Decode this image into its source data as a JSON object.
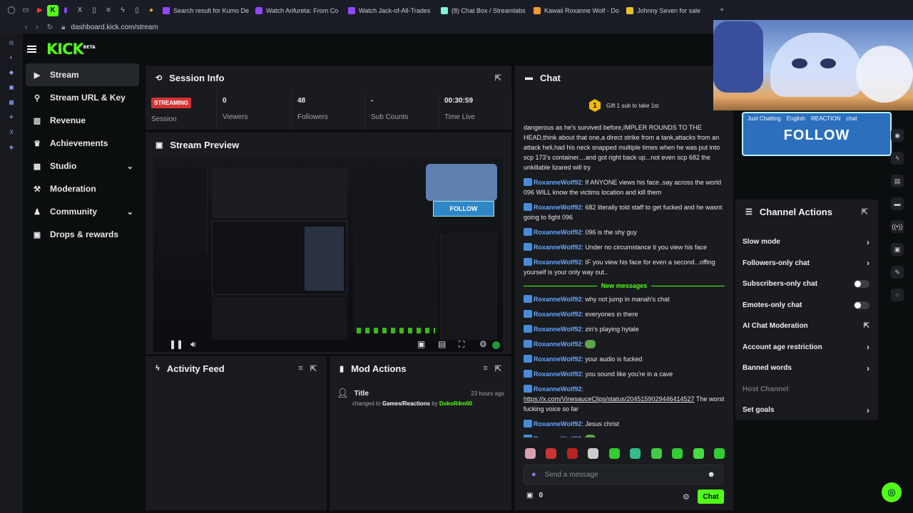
{
  "browser": {
    "tabs": [
      {
        "label": "Search result for Kumo De",
        "color": "#9146ff"
      },
      {
        "label": "Watch Arifureta: From Co",
        "color": "#9146ff"
      },
      {
        "label": "Watch Jack-of-All-Trades",
        "color": "#9146ff"
      },
      {
        "label": "(8) Chat Box / Streamlabs",
        "color": "#80f5d2"
      },
      {
        "label": "Kawaii Roxanne Wolf - Do",
        "color": "#f09a36"
      },
      {
        "label": "Johnny Seven for sale",
        "color": "#e6c229"
      }
    ],
    "url": "dashboard.kick.com/stream"
  },
  "brand": {
    "logo": "KICK",
    "beta": "BETA",
    "accent": "#53fc18"
  },
  "nav": {
    "items": [
      {
        "label": "Stream",
        "icon": "video-icon"
      },
      {
        "label": "Stream URL & Key",
        "icon": "link-icon"
      },
      {
        "label": "Revenue",
        "icon": "chart-icon"
      },
      {
        "label": "Achievements",
        "icon": "trophy-icon"
      },
      {
        "label": "Studio",
        "icon": "grid-icon"
      },
      {
        "label": "Moderation",
        "icon": "gavel-icon"
      },
      {
        "label": "Community",
        "icon": "people-icon"
      },
      {
        "label": "Drops & rewards",
        "icon": "gift-icon"
      }
    ]
  },
  "session": {
    "title": "Session Info",
    "status_badge": "STREAMING",
    "stats": [
      {
        "value": "",
        "label": "Session"
      },
      {
        "value": "0",
        "label": "Viewers"
      },
      {
        "value": "48",
        "label": "Followers"
      },
      {
        "value": "-",
        "label": "Sub Counts"
      },
      {
        "value": "00:30:59",
        "label": "Time Live"
      }
    ]
  },
  "preview": {
    "title": "Stream Preview"
  },
  "activity": {
    "title": "Activity Feed"
  },
  "mod": {
    "title": "Mod Actions",
    "entry": {
      "title": "Title",
      "time": "23 hours ago",
      "prefix": "changed to",
      "category": "Games/Reactions",
      "by": "by",
      "moderator": "DokoR4m60"
    }
  },
  "chat": {
    "title": "Chat",
    "gift_count": "1",
    "gift_text": "Gift 1 sub to take 1st",
    "top_text": "dangerous as he's survived before,IMPLER ROUNDS TO THE HEAD,think about that one,a direct strike from a tank,attacks from an attack heli,had his neck snapped multiple times when he was put into scp 173's container....and got right back up...not even scp 682 the unkillable lizared will try",
    "messages": [
      {
        "user": "RoxanneWolf92",
        "text": "If ANYONE views his face..say across the world 096 WILL know the victims location and kill them"
      },
      {
        "user": "RoxanneWolf92",
        "text": "682 literally told staff to get fucked and he wasnt going to fight 096"
      },
      {
        "user": "RoxanneWolf92",
        "text": "096 is the shy guy"
      },
      {
        "user": "RoxanneWolf92",
        "text": "Under no circumstance ti you view his face"
      },
      {
        "user": "RoxanneWolf92",
        "text": "IF you view his face for even a second...offing yourself is your only way out.."
      }
    ],
    "new_messages_label": "New messages",
    "new": [
      {
        "user": "RoxanneWolf92",
        "text": "why not jump in manah's chat"
      },
      {
        "user": "RoxanneWolf92",
        "text": "everyones in there"
      },
      {
        "user": "RoxanneWolf92",
        "text": "zin's playing hytale"
      },
      {
        "user": "RoxanneWolf92",
        "text": ""
      },
      {
        "user": "RoxanneWolf92",
        "text": "your audio is fucked"
      },
      {
        "user": "RoxanneWolf92",
        "text": "you sound like you're in a cave"
      }
    ],
    "link_msg": {
      "user": "RoxanneWolf92",
      "link": "https://x.com/VinesauceClips/status/2045159029446414527",
      "text": "The worst fucking voice so far"
    },
    "last": [
      {
        "user": "RoxanneWolf92",
        "text": "Jesus christ"
      },
      {
        "user": "RoxanneWolf92",
        "text": ""
      }
    ],
    "placeholder": "Send a message",
    "points": "0",
    "send_label": "Chat"
  },
  "overlay": {
    "tags": [
      "Just Chatting",
      "English",
      "REACTION",
      "chat"
    ],
    "follow": "FOLLOW"
  },
  "channel_actions": {
    "title": "Channel Actions",
    "items": [
      {
        "label": "Slow mode",
        "control": "chevron"
      },
      {
        "label": "Followers-only chat",
        "control": "chevron"
      },
      {
        "label": "Subscribers-only chat",
        "control": "toggle",
        "on": false
      },
      {
        "label": "Emotes-only chat",
        "control": "toggle",
        "on": false
      },
      {
        "label": "AI Chat Moderation",
        "control": "external"
      },
      {
        "label": "Account age restriction",
        "control": "chevron"
      },
      {
        "label": "Banned words",
        "control": "chevron"
      },
      {
        "label": "Host Channel",
        "control": "none"
      },
      {
        "label": "Set goals",
        "control": "chevron"
      }
    ]
  }
}
